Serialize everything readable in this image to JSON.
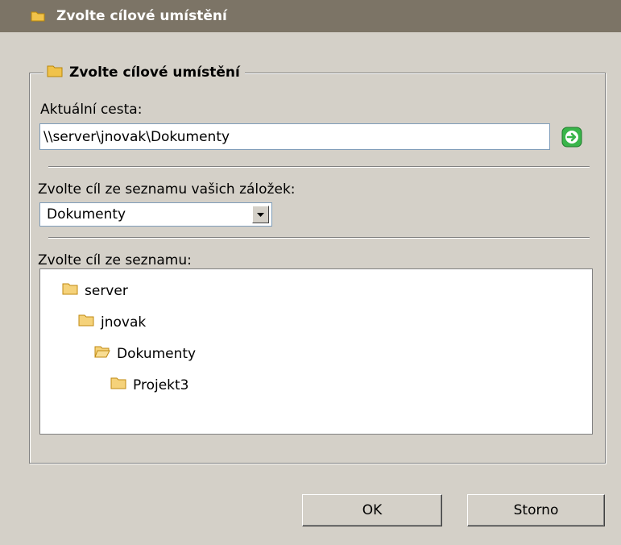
{
  "window": {
    "title": "Zvolte cílové umístění"
  },
  "group": {
    "title": "Zvolte cílové umístění"
  },
  "path": {
    "label": "Aktuální cesta:",
    "value": "\\\\server\\jnovak\\Dokumenty"
  },
  "bookmarks": {
    "label": "Zvolte cíl ze seznamu vašich záložek:",
    "selected": "Dokumenty"
  },
  "tree": {
    "label": "Zvolte cíl ze seznamu:",
    "nodes": [
      {
        "label": "server",
        "icon": "folder-icon"
      },
      {
        "label": "jnovak",
        "icon": "folder-icon"
      },
      {
        "label": "Dokumenty",
        "icon": "folder-open-icon"
      },
      {
        "label": "Projekt3",
        "icon": "folder-icon"
      }
    ]
  },
  "buttons": {
    "ok": "OK",
    "cancel": "Storno"
  },
  "colors": {
    "titlebar": "#7c7466",
    "window_bg": "#d4d0c8",
    "folder": "#f0c24a",
    "go_button": "#39b54a"
  }
}
